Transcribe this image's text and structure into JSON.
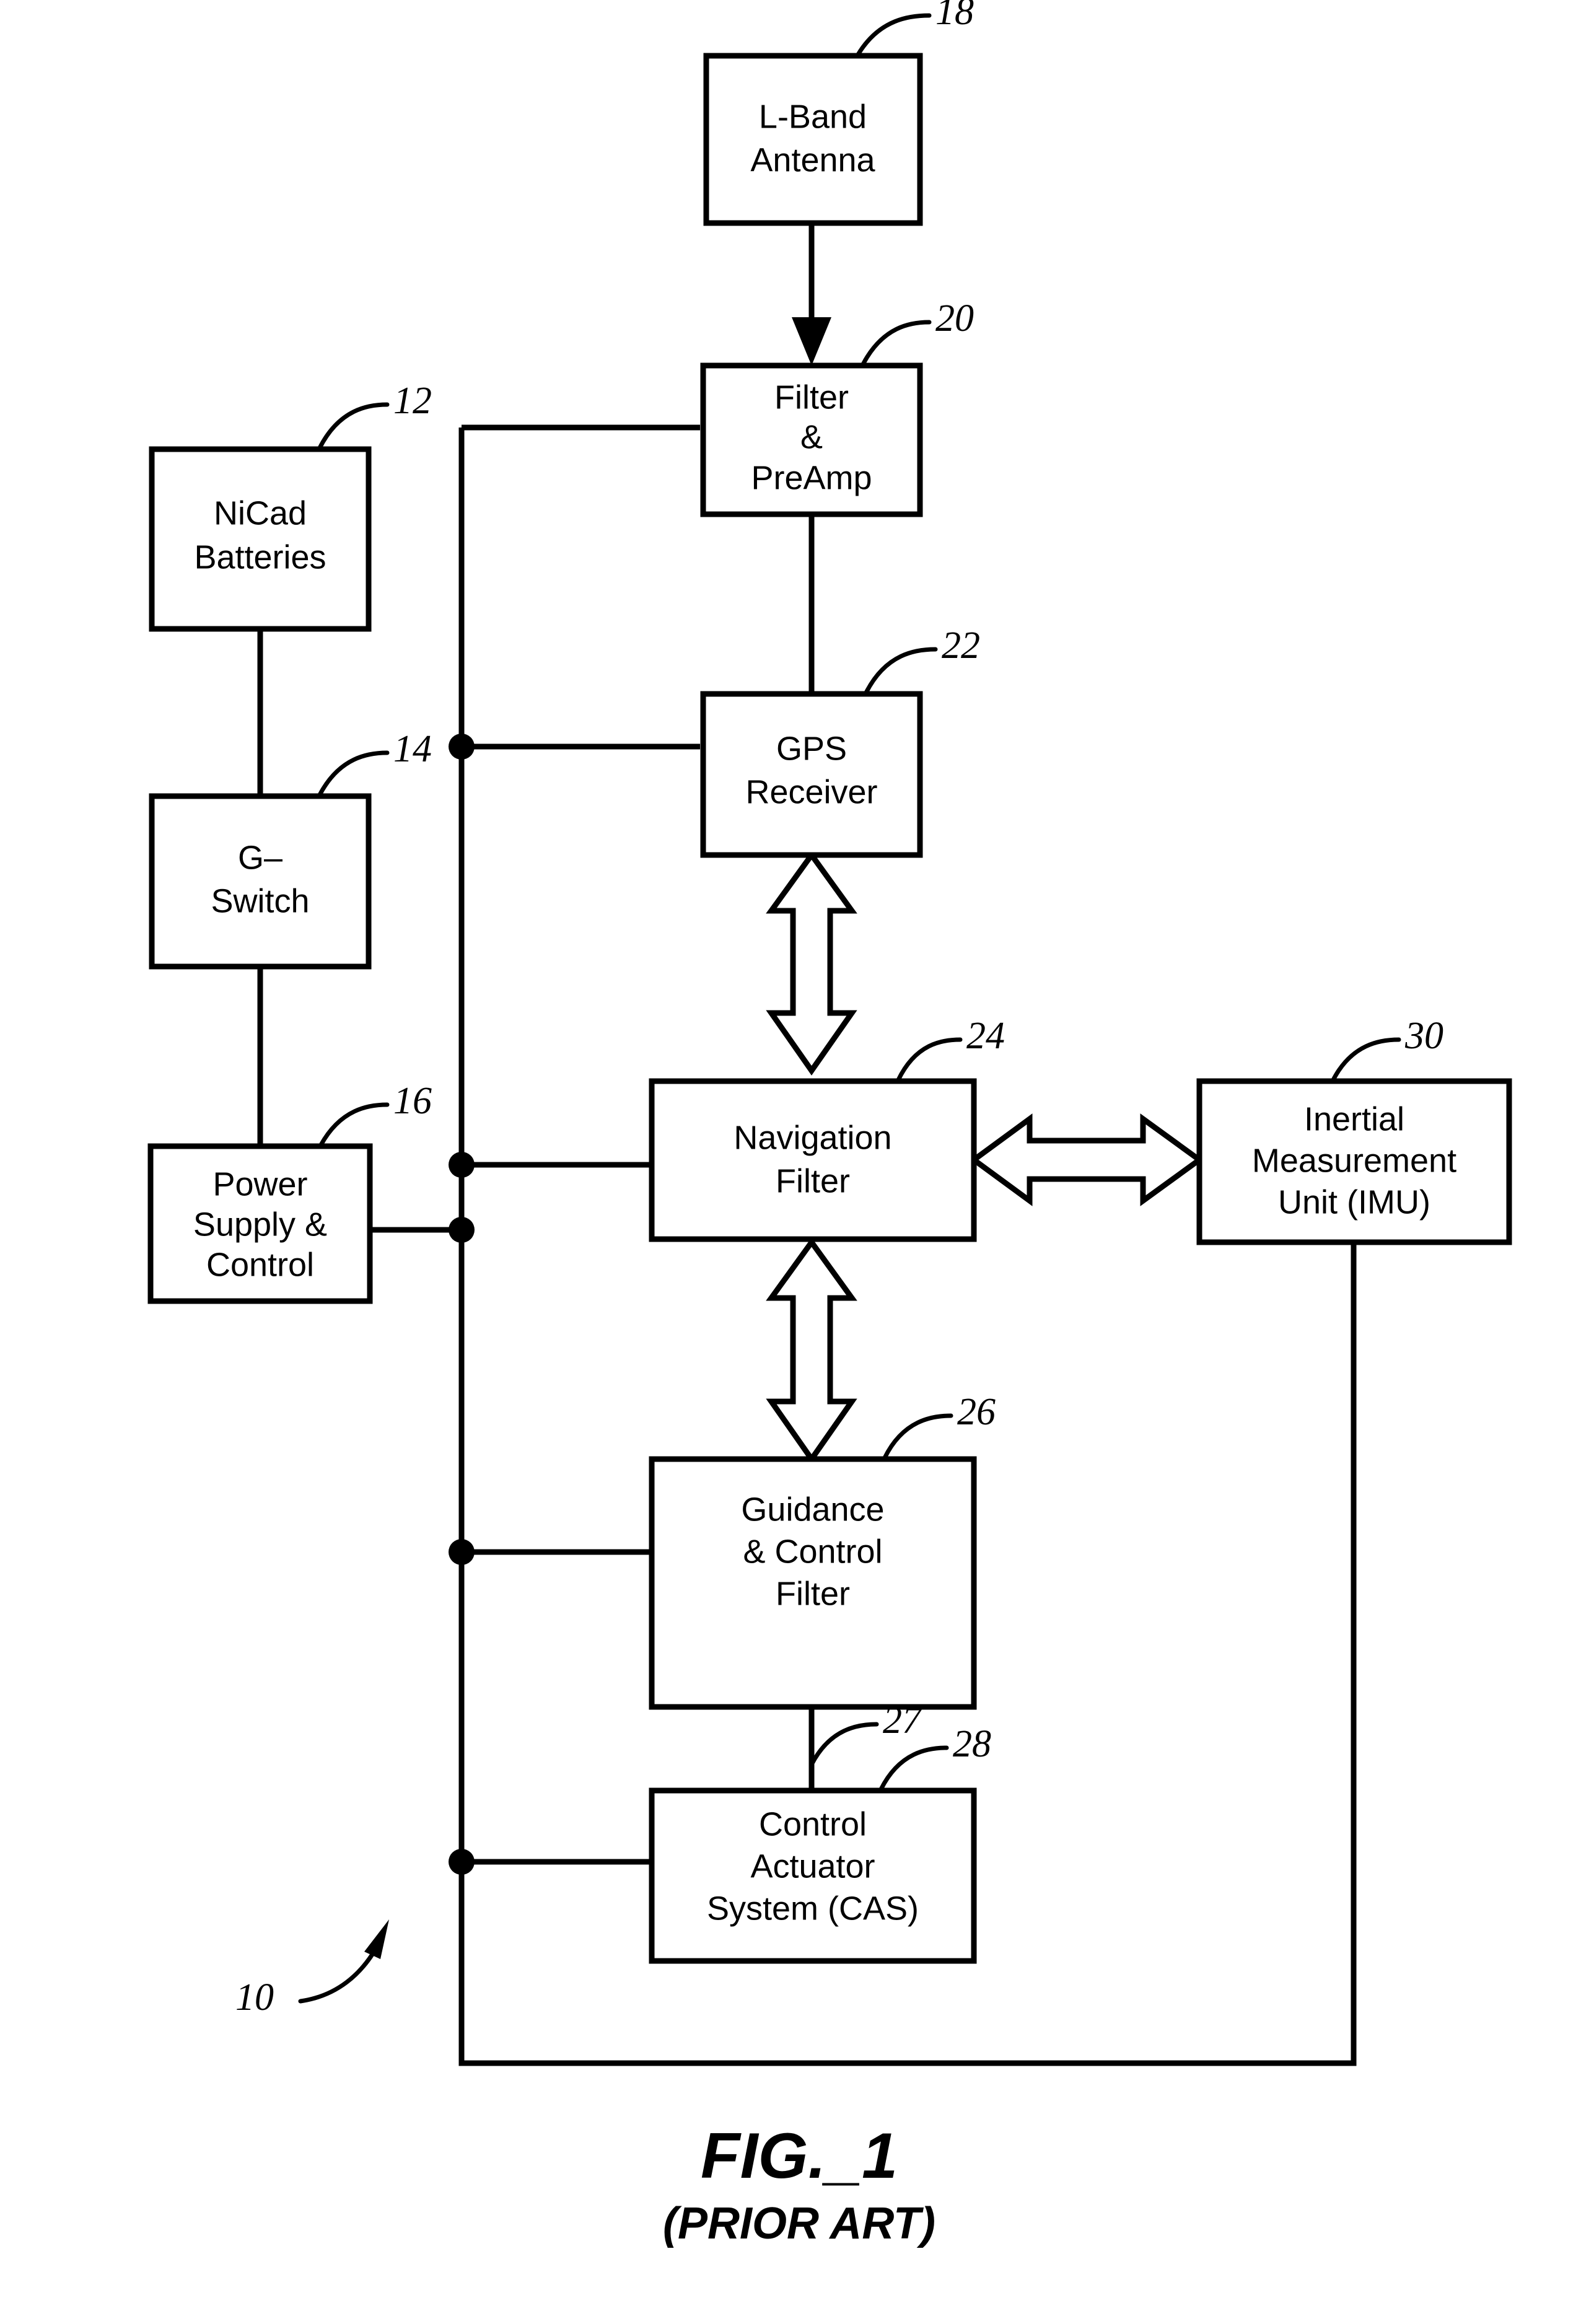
{
  "figure": {
    "title": "FIG._1",
    "subtitle": "(PRIOR ART)",
    "system_ref": "10"
  },
  "blocks": {
    "l_band_antenna": {
      "ref": "18",
      "lines": [
        "L-Band",
        "Antenna"
      ]
    },
    "filter_preamp": {
      "ref": "20",
      "lines": [
        "Filter",
        "&",
        "PreAmp"
      ]
    },
    "gps_receiver": {
      "ref": "22",
      "lines": [
        "GPS",
        "Receiver"
      ]
    },
    "navigation_filter": {
      "ref": "24",
      "lines": [
        "Navigation",
        "Filter"
      ]
    },
    "guidance_control_filter": {
      "ref": "26",
      "lines": [
        "Guidance",
        "& Control",
        "Filter"
      ]
    },
    "control_actuator_system": {
      "ref": "28",
      "lines": [
        "Control",
        "Actuator",
        "System (CAS)"
      ]
    },
    "inertial_measurement_unit": {
      "ref": "30",
      "lines": [
        "Inertial",
        "Measurement",
        "Unit (IMU)"
      ]
    },
    "nicad_batteries": {
      "ref": "12",
      "lines": [
        "NiCad",
        "Batteries"
      ]
    },
    "g_switch": {
      "ref": "14",
      "lines": [
        "G–",
        "Switch"
      ]
    },
    "power_supply_control": {
      "ref": "16",
      "lines": [
        "Power",
        "Supply &",
        "Control"
      ]
    }
  },
  "connection_refs": {
    "gc_to_cas": "27"
  },
  "colors": {
    "ink": "#000000",
    "paper": "#ffffff"
  }
}
